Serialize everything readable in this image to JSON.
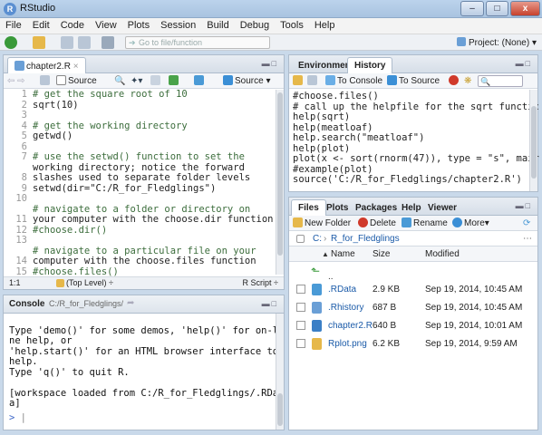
{
  "window": {
    "title": "RStudio",
    "minimize": "–",
    "maximize": "□",
    "close": "x"
  },
  "menu": [
    "File",
    "Edit",
    "Code",
    "View",
    "Plots",
    "Session",
    "Build",
    "Debug",
    "Tools",
    "Help"
  ],
  "toolbar": {
    "go_to_function": "Go to file/function",
    "project": "Project: (None)",
    "project_caret": "▾"
  },
  "editor": {
    "tab": "chapter2.R",
    "tab_close": "×",
    "source_on_save": "Source",
    "run": "Run",
    "source_btn": "Source",
    "source_caret": "▾",
    "line_numbers": [
      "1",
      "2",
      "3",
      "4",
      "5",
      "6",
      "7",
      "",
      "8",
      "9",
      "10",
      "",
      "11",
      "12",
      "13",
      "",
      "14",
      "15"
    ],
    "lines": [
      "# get the square root of 10",
      "sqrt(10)",
      "",
      "# get the working directory",
      "getwd()",
      "",
      "# use the setwd() function to set the",
      "working directory; notice the forward",
      "slashes used to separate folder levels",
      "setwd(dir=\"C:/R_for_Fledglings\")",
      "",
      "# navigate to a folder or directory on",
      "your computer with the choose.dir function",
      "#choose.dir()",
      "",
      "# navigate to a particular file on your",
      "computer with the choose.files function",
      "#choose.files()"
    ],
    "status_pos": "1:1",
    "status_level": "(Top Level) ÷",
    "status_type": "R Script ÷"
  },
  "console": {
    "title": "Console",
    "path": "C:/R_for_Fledglings/",
    "lines": [
      "",
      "Type 'demo()' for some demos, 'help()' for on-li",
      "ne help, or",
      "'help.start()' for an HTML browser interface to",
      "help.",
      "Type 'q()' to quit R.",
      "",
      "[workspace loaded from C:/R_for_Fledglings/.RDat",
      "a]",
      ""
    ],
    "prompt": ">"
  },
  "history": {
    "tabs": [
      "Environment",
      "History"
    ],
    "to_console": "To Console",
    "to_source": "To Source",
    "lines": [
      "#choose.files()",
      "# call up the helpfile for the sqrt functic",
      "help(sqrt)",
      "help(meatloaf)",
      "help.search(\"meatloaf\")",
      "help(plot)",
      "plot(x <- sort(rnorm(47)), type = \"s\", mair",
      "#example(plot)",
      "source('C:/R_for_Fledglings/chapter2.R')"
    ]
  },
  "files": {
    "tabs": [
      "Files",
      "Plots",
      "Packages",
      "Help",
      "Viewer"
    ],
    "new_folder": "New Folder",
    "delete": "Delete",
    "rename": "Rename",
    "more": "More",
    "crumb_root": "C:",
    "crumb_sep": "›",
    "crumb_dir": "R_for_Fledglings",
    "columns": {
      "name": "Name",
      "size": "Size",
      "modified": "Modified",
      "sort": "▲"
    },
    "up": "..",
    "rows": [
      {
        "name": ".RData",
        "size": "2.9 KB",
        "modified": "Sep 19, 2014, 10:45 AM"
      },
      {
        "name": ".Rhistory",
        "size": "687 B",
        "modified": "Sep 19, 2014, 10:45 AM"
      },
      {
        "name": "chapter2.R",
        "size": "640 B",
        "modified": "Sep 19, 2014, 10:01 AM"
      },
      {
        "name": "Rplot.png",
        "size": "6.2 KB",
        "modified": "Sep 19, 2014, 9:59 AM"
      }
    ]
  }
}
